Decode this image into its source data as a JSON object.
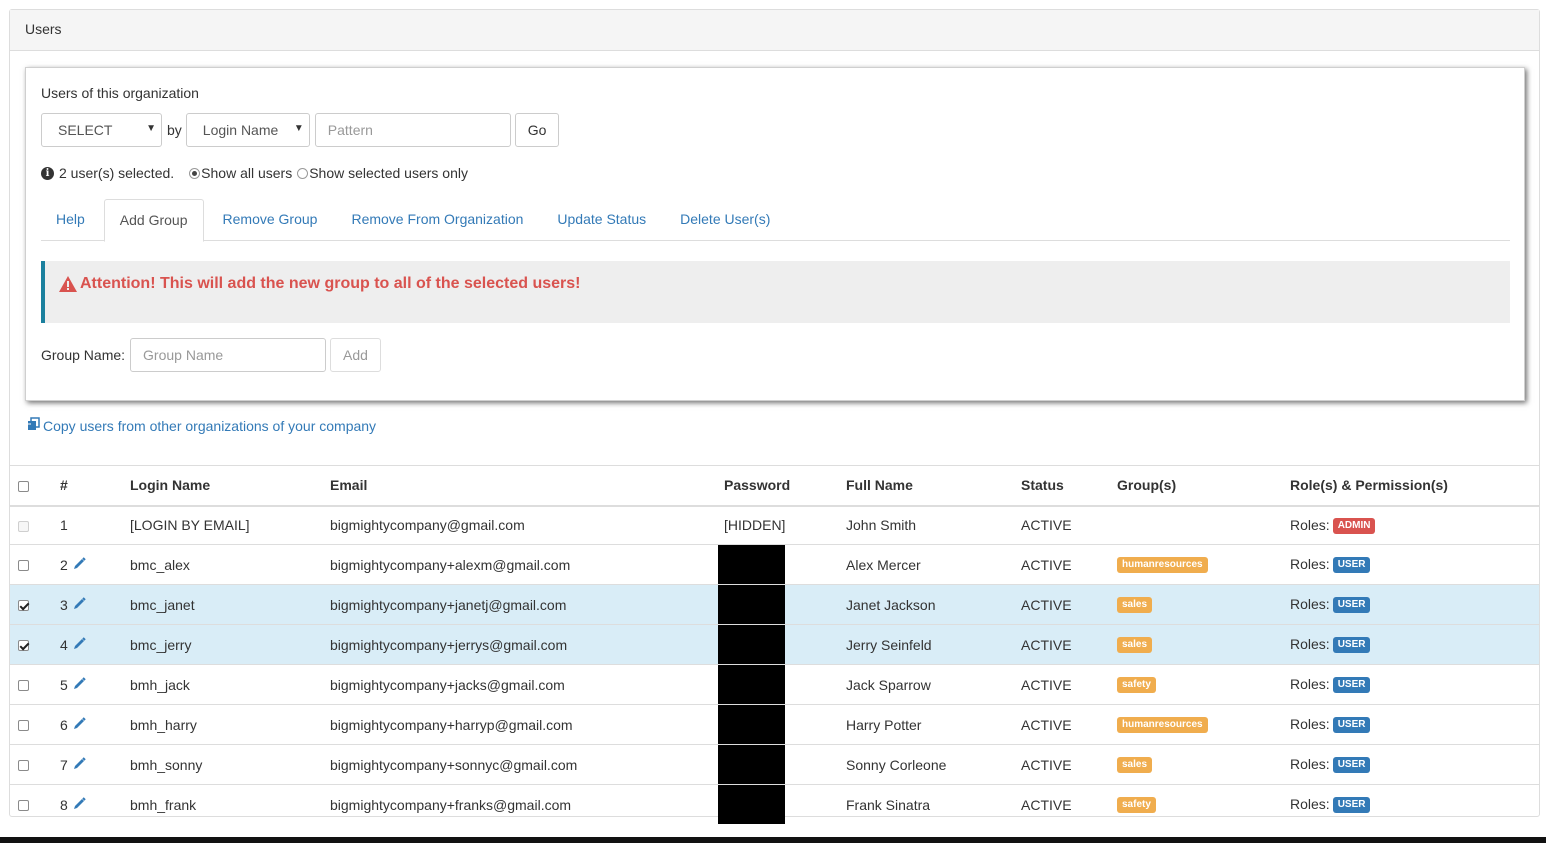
{
  "panel": {
    "title": "Users"
  },
  "filter": {
    "section_title": "Users of this organization",
    "select_value": "SELECT",
    "by_label": "by",
    "field_value": "Login Name",
    "pattern_placeholder": "Pattern",
    "go_label": "Go"
  },
  "selection": {
    "selected_text": "2 user(s) selected.",
    "show_all_label": "Show all users",
    "show_selected_label": "Show selected users only"
  },
  "tabs": [
    "Help",
    "Add Group",
    "Remove Group",
    "Remove From Organization",
    "Update Status",
    "Delete User(s)"
  ],
  "active_tab": "Add Group",
  "attention": {
    "text": "Attention! This will add the new group to all of the selected users!"
  },
  "group_form": {
    "label": "Group Name:",
    "placeholder": "Group Name",
    "add_label": "Add"
  },
  "copy_link": "Copy users from other organizations of your company",
  "table": {
    "headers": {
      "num": "#",
      "login": "Login Name",
      "email": "Email",
      "password": "Password",
      "fullname": "Full Name",
      "status": "Status",
      "groups": "Group(s)",
      "roles": "Role(s) & Permission(s)"
    },
    "roles_prefix": "Roles:",
    "rows": [
      {
        "num": "1",
        "login": "[LOGIN BY EMAIL]",
        "email": "bigmightycompany@gmail.com",
        "password": "[HIDDEN]",
        "fullname": "John Smith",
        "status": "ACTIVE",
        "group": "",
        "role": "ADMIN"
      },
      {
        "num": "2",
        "login": "bmc_alex",
        "email": "bigmightycompany+alexm@gmail.com",
        "password": "",
        "fullname": "Alex Mercer",
        "status": "ACTIVE",
        "group": "humanresources",
        "role": "USER"
      },
      {
        "num": "3",
        "login": "bmc_janet",
        "email": "bigmightycompany+janetj@gmail.com",
        "password": "",
        "fullname": "Janet Jackson",
        "status": "ACTIVE",
        "group": "sales",
        "role": "USER"
      },
      {
        "num": "4",
        "login": "bmc_jerry",
        "email": "bigmightycompany+jerrys@gmail.com",
        "password": "",
        "fullname": "Jerry Seinfeld",
        "status": "ACTIVE",
        "group": "sales",
        "role": "USER"
      },
      {
        "num": "5",
        "login": "bmh_jack",
        "email": "bigmightycompany+jacks@gmail.com",
        "password": "",
        "fullname": "Jack Sparrow",
        "status": "ACTIVE",
        "group": "safety",
        "role": "USER"
      },
      {
        "num": "6",
        "login": "bmh_harry",
        "email": "bigmightycompany+harryp@gmail.com",
        "password": "",
        "fullname": "Harry Potter",
        "status": "ACTIVE",
        "group": "humanresources",
        "role": "USER"
      },
      {
        "num": "7",
        "login": "bmh_sonny",
        "email": "bigmightycompany+sonnyc@gmail.com",
        "password": "",
        "fullname": "Sonny Corleone",
        "status": "ACTIVE",
        "group": "sales",
        "role": "USER"
      },
      {
        "num": "8",
        "login": "bmh_frank",
        "email": "bigmightycompany+franks@gmail.com",
        "password": "",
        "fullname": "Frank Sinatra",
        "status": "ACTIVE",
        "group": "safety",
        "role": "USER"
      }
    ]
  },
  "colors": {
    "link": "#337ab7",
    "danger": "#d9534f",
    "warning": "#f0ad4e",
    "selected_row": "#d9edf7",
    "attention_border": "#1b809e"
  },
  "icons": {
    "info": "info-circle-icon",
    "warning": "warning-triangle-icon",
    "copy": "copy-users-icon",
    "edit": "pencil-icon"
  }
}
